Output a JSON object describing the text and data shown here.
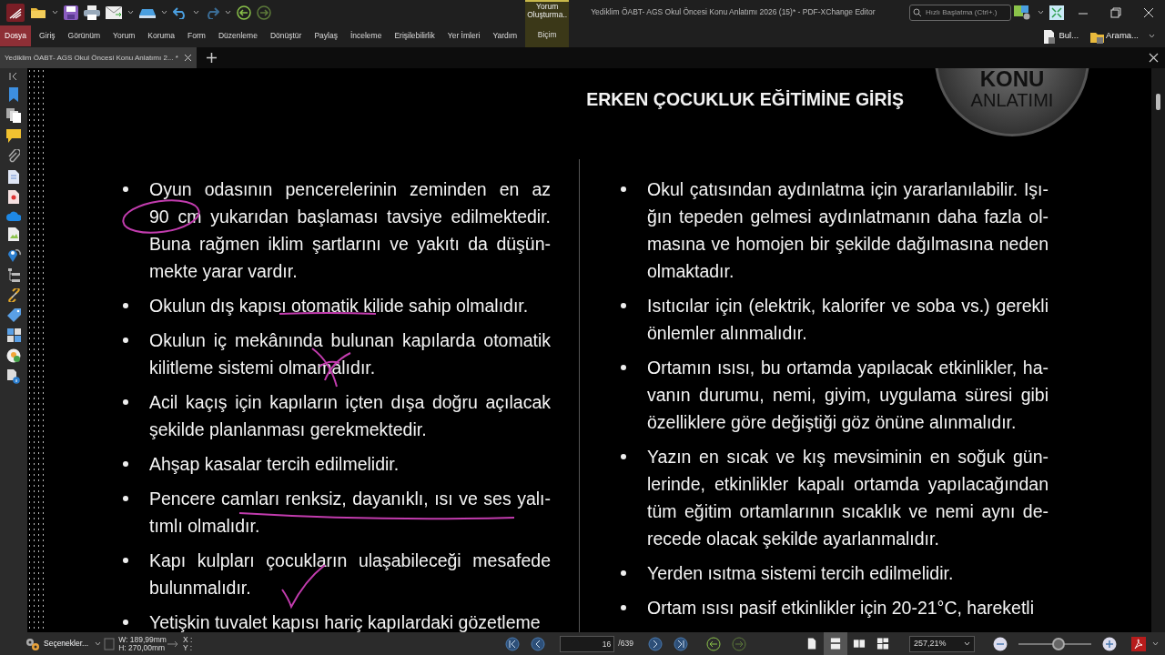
{
  "app": {
    "title": "Yediklim ÖABT- AGS Okul Öncesi Konu Anlatımı 2026 (15)* - PDF-XChange Editor",
    "search_placeholder": "Hızlı Başlatma (Ctrl+.)"
  },
  "contextual_group": "Yorum Oluşturma..",
  "ribbon_tabs": [
    {
      "label": "Dosya",
      "kind": "file",
      "selected": true
    },
    {
      "label": "Giriş",
      "kind": "normal",
      "selected": false
    },
    {
      "label": "Görünüm",
      "kind": "normal",
      "selected": false
    },
    {
      "label": "Yorum",
      "kind": "normal",
      "selected": false
    },
    {
      "label": "Koruma",
      "kind": "normal",
      "selected": false
    },
    {
      "label": "Form",
      "kind": "normal",
      "selected": false
    },
    {
      "label": "Düzenleme",
      "kind": "normal",
      "selected": false
    },
    {
      "label": "Dönüştür",
      "kind": "normal",
      "selected": false
    },
    {
      "label": "Paylaş",
      "kind": "normal",
      "selected": false
    },
    {
      "label": "İnceleme",
      "kind": "normal",
      "selected": false
    },
    {
      "label": "Erişilebilirlik",
      "kind": "normal",
      "selected": false
    },
    {
      "label": "Yer İmleri",
      "kind": "normal",
      "selected": false
    },
    {
      "label": "Yardım",
      "kind": "normal",
      "selected": false
    },
    {
      "label": "Biçim",
      "kind": "contextual",
      "selected": false
    }
  ],
  "ribbon_right": [
    {
      "label": "Bul..."
    },
    {
      "label": "Arama..."
    }
  ],
  "doc_tabs": [
    {
      "label": "Yediklim ÖABT- AGS Okul Öncesi Konu Anlatımı 2... *",
      "selected": true
    }
  ],
  "page": {
    "header": "ERKEN ÇOCUKLUK EĞİTİMİNE GİRİŞ",
    "logo": [
      "KONU",
      "ANLATIMI"
    ],
    "columns": [
      {
        "bullets": [
          {
            "lines": [
              "Oyun odasının pencerelerinin zeminden en az",
              "90 cm yukarıdan başlaması tavsiye edilmektedir.",
              "Buna rağmen iklim şartlarını ve yakıtı da düşün-",
              "mekte yarar vardır."
            ]
          },
          {
            "lines": [
              "Okulun dış kapısı otomatik kilide sahip olmalıdır."
            ]
          },
          {
            "lines": [
              "Okulun iç mekânında bulunan kapılarda otomatik",
              "kilitleme sistemi olmamalıdır."
            ]
          },
          {
            "lines": [
              "Acil kaçış için kapıların içten dışa doğru açılacak",
              "şekilde planlanması gerekmektedir."
            ]
          },
          {
            "lines": [
              "Ahşap kasalar tercih edilmelidir."
            ]
          },
          {
            "lines": [
              "Pencere camları renksiz, dayanıklı, ısı ve ses yalı-",
              "tımlı olmalıdır."
            ]
          },
          {
            "lines": [
              "Kapı kulpları çocukların ulaşabileceği mesafede",
              "bulunmalıdır."
            ]
          },
          {
            "lines": [
              "Yetişkin tuvalet kapısı hariç kapılardaki gözetleme"
            ]
          }
        ]
      },
      {
        "bullets": [
          {
            "lines": [
              "Okul çatısından aydınlatma için yararlanılabilir. Işı-",
              "ğın tepeden gelmesi aydınlatmanın daha fazla ol-",
              "masına ve homojen bir şekilde dağılmasına neden",
              "olmaktadır."
            ]
          },
          {
            "lines": [
              "Isıtıcılar için (elektrik, kalorifer ve soba vs.) gerekli",
              "önlemler alınmalıdır."
            ]
          },
          {
            "lines": [
              "Ortamın ısısı, bu ortamda yapılacak etkinlikler, ha-",
              "vanın durumu, nemi, giyim, uygulama süresi gibi",
              "özelliklere göre değiştiği göz önüne alınmalıdır."
            ]
          },
          {
            "lines": [
              "Yazın en sıcak ve kış mevsiminin en soğuk gün-",
              "lerinde, etkinlikler kapalı ortamda yapılacağından",
              "tüm eğitim ortamlarının sıcaklık ve nemi aynı de-",
              "recede olacak şekilde ayarlanmalıdır."
            ]
          },
          {
            "lines": [
              "Yerden ısıtma sistemi tercih edilmelidir."
            ]
          },
          {
            "lines": [
              "Ortam ısısı pasif etkinlikler için 20-21°C, hareketli"
            ]
          }
        ]
      }
    ]
  },
  "status_bar": {
    "options": "Seçenekler...",
    "width": "W: 189,99mm",
    "height": "H: 270,00mm",
    "x": "X :",
    "y": "Y :",
    "page": "16",
    "page_count": "/639",
    "view_modes": [
      {
        "kind": "single",
        "selected": false
      },
      {
        "kind": "continuous",
        "selected": true
      },
      {
        "kind": "facing",
        "selected": false
      },
      {
        "kind": "facing-continuous",
        "selected": false
      }
    ],
    "zoom": "257,21%",
    "zoom_slider": {
      "level": 0.55
    }
  }
}
